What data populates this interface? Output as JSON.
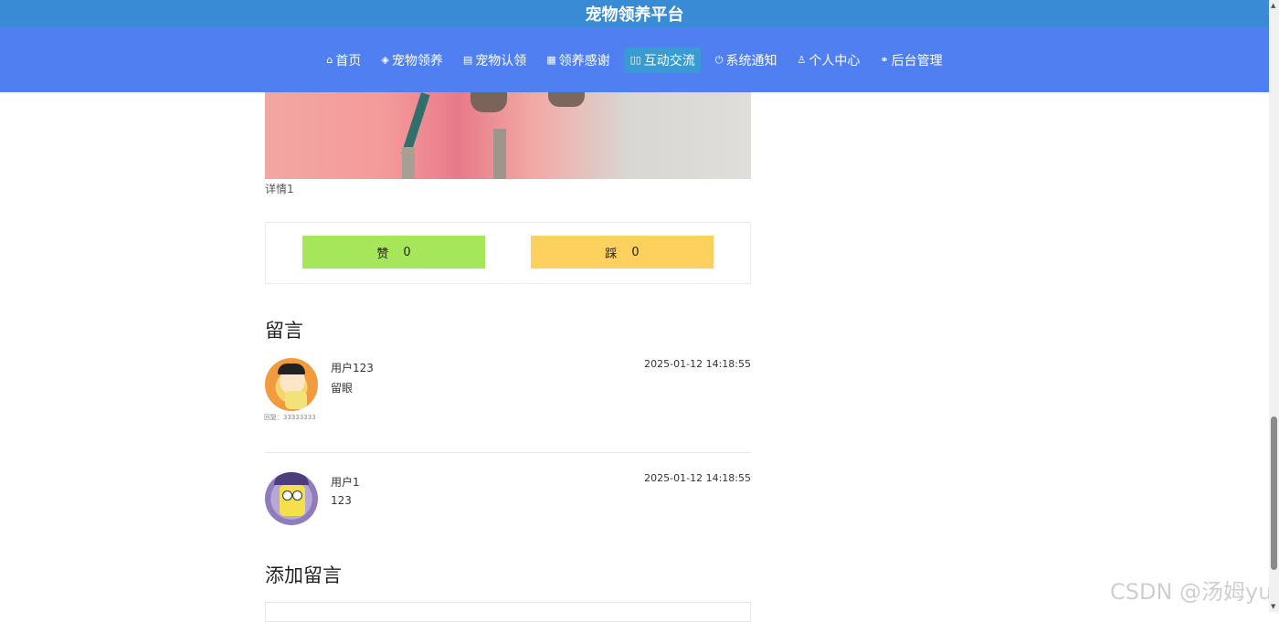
{
  "site": {
    "title": "宠物领养平台"
  },
  "nav": {
    "items": [
      {
        "icon": "⌂",
        "label": "首页"
      },
      {
        "icon": "◈",
        "label": "宠物领养"
      },
      {
        "icon": "▤",
        "label": "宠物认领"
      },
      {
        "icon": "▦",
        "label": "领养感谢"
      },
      {
        "icon": "▯▯",
        "label": "互动交流",
        "active": true
      },
      {
        "icon": "⏻",
        "label": "系统通知"
      },
      {
        "icon": "♙",
        "label": "个人中心"
      },
      {
        "icon": "⚭",
        "label": "后台管理"
      }
    ]
  },
  "post": {
    "detail": "详情1",
    "like_label": "赞",
    "like_count": "0",
    "dislike_label": "踩",
    "dislike_count": "0"
  },
  "comments_section": {
    "title": "留言",
    "items": [
      {
        "user": "用户123",
        "text": "留眼",
        "time": "2025-01-12 14:18:55",
        "reply": "回复：33333333"
      },
      {
        "user": "用户1",
        "text": "123",
        "time": "2025-01-12 14:18:55"
      }
    ]
  },
  "add_comment": {
    "title": "添加留言"
  },
  "watermark": "CSDN @汤姆yu",
  "colors": {
    "topbar": "#3a8bd6",
    "navbar": "#4f7ff0",
    "like": "#a5e65a",
    "dislike": "#fed05e"
  }
}
